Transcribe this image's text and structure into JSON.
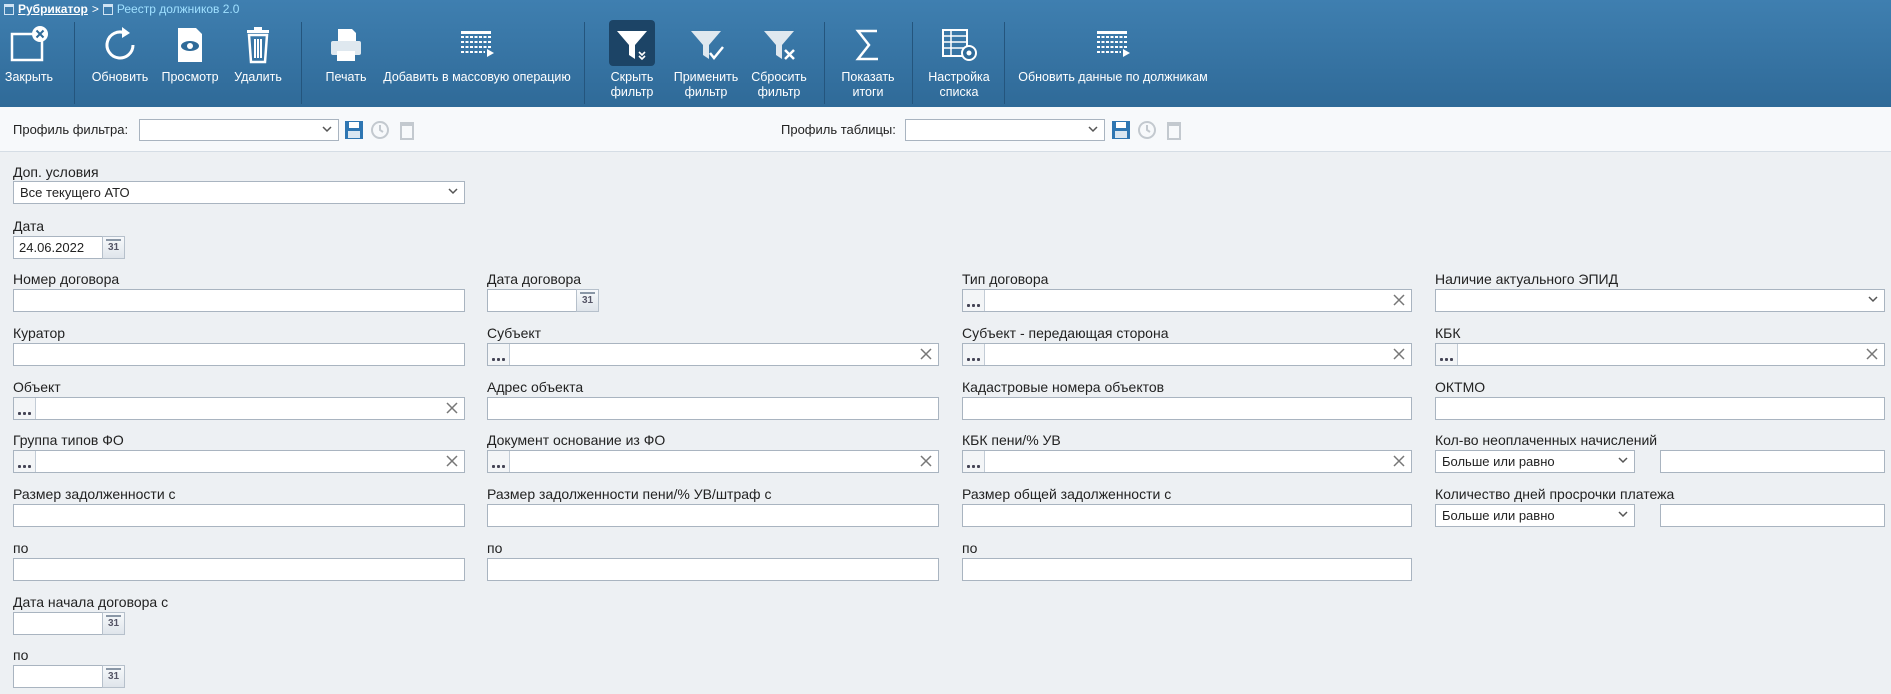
{
  "breadcrumb": {
    "root": "Рубрикатор",
    "separator": ">",
    "current": "Реестр должников 2.0"
  },
  "toolbar": {
    "close": "Закрыть",
    "refresh": "Обновить",
    "view": "Просмотр",
    "delete": "Удалить",
    "print": "Печать",
    "add_mass": "Добавить в массовую операцию",
    "hide_filter_1": "Скрыть",
    "hide_filter_2": "фильтр",
    "apply_filter_1": "Применить",
    "apply_filter_2": "фильтр",
    "reset_filter_1": "Сбросить",
    "reset_filter_2": "фильтр",
    "totals_1": "Показать",
    "totals_2": "итоги",
    "list_settings_1": "Настройка",
    "list_settings_2": "списка",
    "update_debtors": "Обновить данные по должникам"
  },
  "profiles": {
    "filter_label": "Профиль фильтра:",
    "filter_value": "",
    "table_label": "Профиль таблицы:",
    "table_value": ""
  },
  "form": {
    "extra_conditions_label": "Доп. условия",
    "extra_conditions_value": "Все текущего АТО",
    "date_label": "Дата",
    "date_value": "24.06.2022",
    "contract_number_label": "Номер договора",
    "contract_date_label": "Дата договора",
    "contract_type_label": "Тип договора",
    "epid_label": "Наличие актуального ЭПИД",
    "curator_label": "Куратор",
    "subject_label": "Субъект",
    "subject_transfer_label": "Субъект - передающая сторона",
    "kbk_label": "КБК",
    "object_label": "Объект",
    "object_address_label": "Адрес объекта",
    "cadastral_label": "Кадастровые номера объектов",
    "oktmo_label": "ОКТМО",
    "fo_group_label": "Группа типов ФО",
    "fo_document_label": "Документ основание из ФО",
    "kbk_penalty_label": "КБК пени/% УВ",
    "unpaid_count_label": "Кол-во неоплаченных начислений",
    "unpaid_count_op": "Больше или равно",
    "debt_from_label": "Размер задолженности с",
    "penalty_debt_from_label": "Размер задолженности пени/% УВ/штраф с",
    "total_debt_from_label": "Размер общей задолженности с",
    "overdue_days_label": "Количество дней просрочки платежа",
    "overdue_days_op": "Больше или равно",
    "to_label": "по",
    "contract_start_from_label": "Дата начала договора с",
    "calendar_glyph": "31"
  },
  "colors": {
    "toolbar": "#3a78a8",
    "active": "#1c4466",
    "link_current": "#9fe0ff"
  }
}
